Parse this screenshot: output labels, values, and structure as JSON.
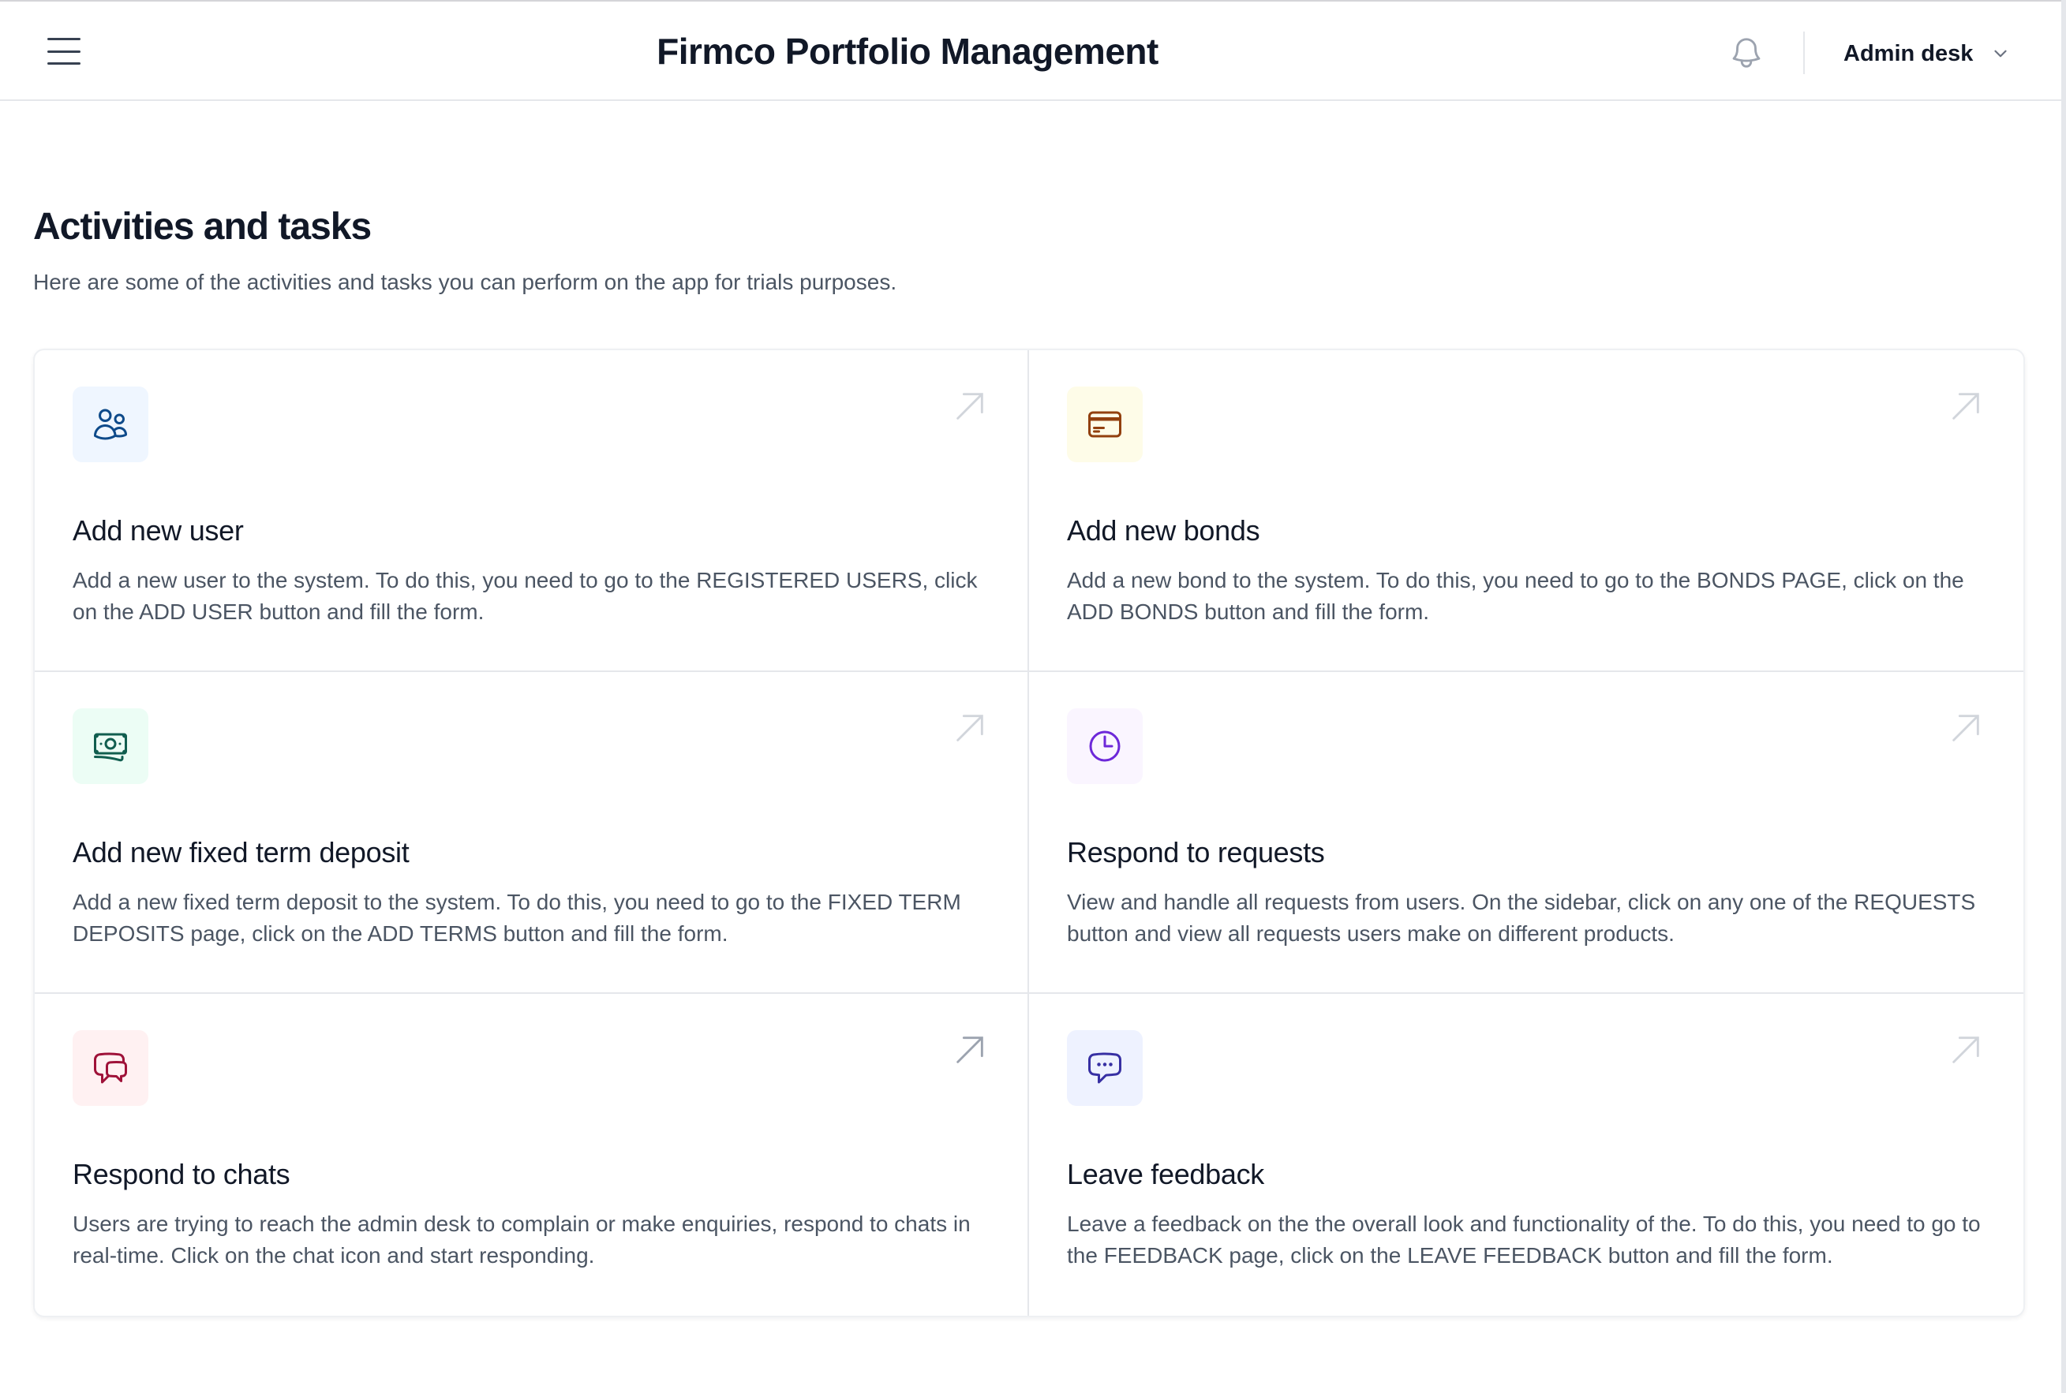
{
  "header": {
    "title": "Firmco Portfolio Management",
    "menu_icon": "hamburger-menu-icon",
    "notification_icon": "bell-icon",
    "user_label": "Admin desk",
    "user_menu_icon": "chevron-down-icon"
  },
  "main": {
    "heading": "Activities and tasks",
    "subheading": "Here are some of the activities and tasks you can perform on the app for trials purposes.",
    "cards": [
      {
        "title": "Add new user",
        "description": "Add a new user to the system. To do this, you need to go to the REGISTERED USERS, click on the ADD USER button and fill the form.",
        "icon": "users-icon",
        "icon_color": "#0e4a8a",
        "icon_bg": "#eff6ff"
      },
      {
        "title": "Add new bonds",
        "description": "Add a new bond to the system. To do this, you need to go to the BONDS PAGE, click on the ADD BONDS button and fill the form.",
        "icon": "credit-card-icon",
        "icon_color": "#92400e",
        "icon_bg": "#fefce8"
      },
      {
        "title": "Add new fixed term deposit",
        "description": "Add a new fixed term deposit to the system. To do this, you need to go to the FIXED TERM DEPOSITS page, click on the ADD TERMS button and fill the form.",
        "icon": "banknotes-icon",
        "icon_color": "#115e4f",
        "icon_bg": "#ecfdf5"
      },
      {
        "title": "Respond to requests",
        "description": "View and handle all requests from users. On the sidebar, click on any one of the REQUESTS button and view all requests users make on different products.",
        "icon": "clock-icon",
        "icon_color": "#6d28d9",
        "icon_bg": "#faf5ff"
      },
      {
        "title": "Respond to chats",
        "description": "Users are trying to reach the admin desk to complain or make enquiries, respond to chats in real-time. Click on the chat icon and start responding.",
        "icon": "chat-bubbles-icon",
        "icon_color": "#9f1239",
        "icon_bg": "#fff1f2"
      },
      {
        "title": "Leave feedback",
        "description": "Leave a feedback on the the overall look and functionality of the. To do this, you need to go to the FEEDBACK page, click on the LEAVE FEEDBACK button and fill the form.",
        "icon": "chat-ellipsis-icon",
        "icon_color": "#3730a3",
        "icon_bg": "#eef2ff"
      }
    ],
    "arrow_icon": "arrow-up-right-icon"
  },
  "colors": {
    "arrow_default": "#d1d5db",
    "arrow_hover": "#9ca3af"
  }
}
